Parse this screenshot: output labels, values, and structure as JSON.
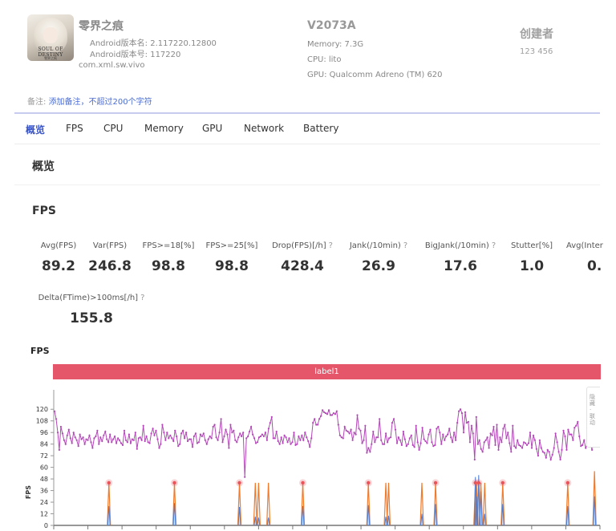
{
  "app": {
    "name": "零界之痕",
    "version": "Android版本名: 2.117220.12800",
    "version_code": "Android版本号: 117220",
    "package": "com.xml.sw.vivo",
    "icon_text": "SOUL OF DESTINY",
    "icon_sub": "零界之痕"
  },
  "device": {
    "name": "V2073A",
    "memory": "Memory: 7.3G",
    "cpu": "CPU: lito",
    "gpu": "GPU: Qualcomm Adreno (TM) 620"
  },
  "creator": {
    "label": "创建者",
    "value": "123 456"
  },
  "note": {
    "label": "备注:",
    "link": "添加备注，不超过200个字符"
  },
  "tabs": [
    {
      "label": "概览",
      "active": true
    },
    {
      "label": "FPS",
      "active": false
    },
    {
      "label": "CPU",
      "active": false
    },
    {
      "label": "Memory",
      "active": false
    },
    {
      "label": "GPU",
      "active": false
    },
    {
      "label": "Network",
      "active": false
    },
    {
      "label": "Battery",
      "active": false
    }
  ],
  "sections": {
    "overview": "概览",
    "fps": "FPS"
  },
  "metrics": [
    {
      "label": "Avg(FPS)",
      "value": "89.2",
      "help": false
    },
    {
      "label": "Var(FPS)",
      "value": "246.8",
      "help": false
    },
    {
      "label": "FPS>=18[%]",
      "value": "98.8",
      "help": false
    },
    {
      "label": "FPS>=25[%]",
      "value": "98.8",
      "help": false
    },
    {
      "label": "Drop(FPS)[/h]",
      "value": "428.4",
      "help": true
    },
    {
      "label": "Jank(/10min)",
      "value": "26.9",
      "help": true
    },
    {
      "label": "BigJank(/10min)",
      "value": "17.6",
      "help": true
    },
    {
      "label": "Stutter[%]",
      "value": "1.0",
      "help": false
    },
    {
      "label": "Avg(Inter",
      "value": "0.",
      "help": false
    },
    {
      "label": "Delta(FTime)>100ms[/h]",
      "value": "155.8",
      "help": true
    }
  ],
  "help_mark": "?",
  "chart": {
    "title": "FPS",
    "band_label": "label1",
    "ylabel": "FPS",
    "side_panel_text": "隐藏 · 联动"
  },
  "colors": {
    "accent": "#3a54c4",
    "band": "#e5566a",
    "fps_line": "#b347b8",
    "jank_line": "#f07b2c",
    "bigjank_line": "#4d7fd6",
    "marker": "#e8545a"
  },
  "chart_data": {
    "type": "line",
    "ylabel": "FPS",
    "ylim": [
      0,
      126
    ],
    "yticks": [
      0,
      12,
      24,
      36,
      48,
      60,
      72,
      84,
      96,
      108,
      120
    ],
    "grid": false,
    "series": [
      {
        "name": "FPS",
        "values": [
          118,
          110,
          96,
          78,
          102,
          95,
          88,
          84,
          93,
          99,
          90,
          85,
          96,
          91,
          88,
          82,
          94,
          89,
          91,
          84,
          89,
          88,
          93,
          86,
          80,
          90,
          92,
          98,
          84,
          91,
          87,
          93,
          97,
          89,
          86,
          94,
          86,
          89,
          92,
          85,
          90,
          88,
          85,
          83,
          98,
          88,
          86,
          94,
          85,
          89,
          88,
          96,
          79,
          90,
          91,
          88,
          103,
          87,
          92,
          86,
          85,
          95,
          100,
          93,
          98,
          89,
          80,
          84,
          104,
          96,
          88,
          96,
          90,
          93,
          90,
          87,
          98,
          92,
          82,
          84,
          95,
          98,
          90,
          96,
          87,
          89,
          89,
          81,
          92,
          95,
          85,
          86,
          94,
          92,
          95,
          88,
          84,
          89,
          92,
          90,
          102,
          104,
          91,
          88,
          96,
          110,
          86,
          92,
          99,
          94,
          80,
          104,
          96,
          98,
          88,
          86,
          91,
          95,
          92,
          96,
          50,
          90,
          92,
          97,
          102,
          94,
          90,
          85,
          86,
          91,
          92,
          94,
          92,
          96,
          88,
          100,
          106,
          112,
          90,
          90,
          97,
          87,
          84,
          91,
          85,
          93,
          91,
          86,
          90,
          84,
          86,
          96,
          83,
          84,
          92,
          88,
          93,
          88,
          96,
          91,
          87,
          81,
          90,
          106,
          110,
          104,
          104,
          110,
          113,
          119,
          117,
          116,
          115,
          119,
          114,
          114,
          116,
          115,
          118,
          104,
          93,
          91,
          90,
          102,
          98,
          97,
          95,
          99,
          88,
          96,
          94,
          114,
          100,
          98,
          85,
          88,
          103,
          75,
          80,
          76,
          84,
          97,
          86,
          91,
          91,
          110,
          88,
          84,
          84,
          95,
          86,
          90,
          91,
          106,
          110,
          99,
          85,
          91,
          88,
          83,
          97,
          89,
          82,
          84,
          90,
          93,
          83,
          81,
          103,
          86,
          78,
          85,
          101,
          89,
          87,
          85,
          94,
          99,
          86,
          82,
          83,
          100,
          102,
          96,
          84,
          94,
          88,
          92,
          94,
          100,
          91,
          86,
          96,
          88,
          106,
          118,
          120,
          116,
          96,
          117,
          106,
          107,
          86,
          103,
          95,
          68,
          112,
          84,
          88,
          79,
          76,
          86,
          88,
          91,
          80,
          95,
          93,
          102,
          83,
          104,
          78,
          91,
          86,
          100,
          104,
          90,
          96,
          85,
          76,
          103,
          82,
          80,
          88,
          83,
          82,
          80,
          86,
          85,
          83,
          85,
          96,
          80,
          93,
          88,
          79,
          72,
          88,
          80,
          76,
          75,
          70,
          78,
          76,
          68,
          73,
          80,
          95,
          86,
          76,
          68,
          78,
          98,
          92,
          78,
          99,
          94,
          94,
          88,
          101,
          103,
          107,
          92,
          82,
          83,
          88,
          80,
          84,
          82,
          85,
          78,
          115,
          93,
          82,
          89
        ],
        "x_range": [
          0,
          1
        ]
      },
      {
        "name": "Jank",
        "type": "spikes",
        "x_frac": [
          0.101,
          0.221,
          0.34,
          0.369,
          0.375,
          0.393,
          0.456,
          0.576,
          0.608,
          0.613,
          0.674,
          0.699,
          0.772,
          0.774,
          0.778,
          0.782,
          0.789,
          0.822,
          0.941,
          0.99
        ],
        "values": [
          44,
          44,
          44,
          44,
          44,
          44,
          44,
          44,
          44,
          44,
          44,
          44,
          44,
          44,
          44,
          44,
          44,
          44,
          44,
          56
        ]
      },
      {
        "name": "BigJank",
        "type": "spikes",
        "x_frac": [
          0.101,
          0.221,
          0.34,
          0.369,
          0.375,
          0.393,
          0.456,
          0.576,
          0.608,
          0.613,
          0.674,
          0.699,
          0.772,
          0.774,
          0.778,
          0.782,
          0.789,
          0.822,
          0.941,
          0.99
        ],
        "values": [
          20,
          23,
          19,
          9,
          8,
          8,
          20,
          21,
          9,
          10,
          12,
          22,
          50,
          30,
          52,
          35,
          12,
          22,
          20,
          30
        ]
      },
      {
        "name": "BigJank markers",
        "type": "markers",
        "x_frac": [
          0.101,
          0.221,
          0.34,
          0.456,
          0.576,
          0.699,
          0.772,
          0.778,
          0.822,
          0.941,
          0.99
        ],
        "values": [
          44,
          44,
          44,
          44,
          44,
          44,
          44,
          44,
          44,
          44,
          86
        ]
      }
    ]
  }
}
